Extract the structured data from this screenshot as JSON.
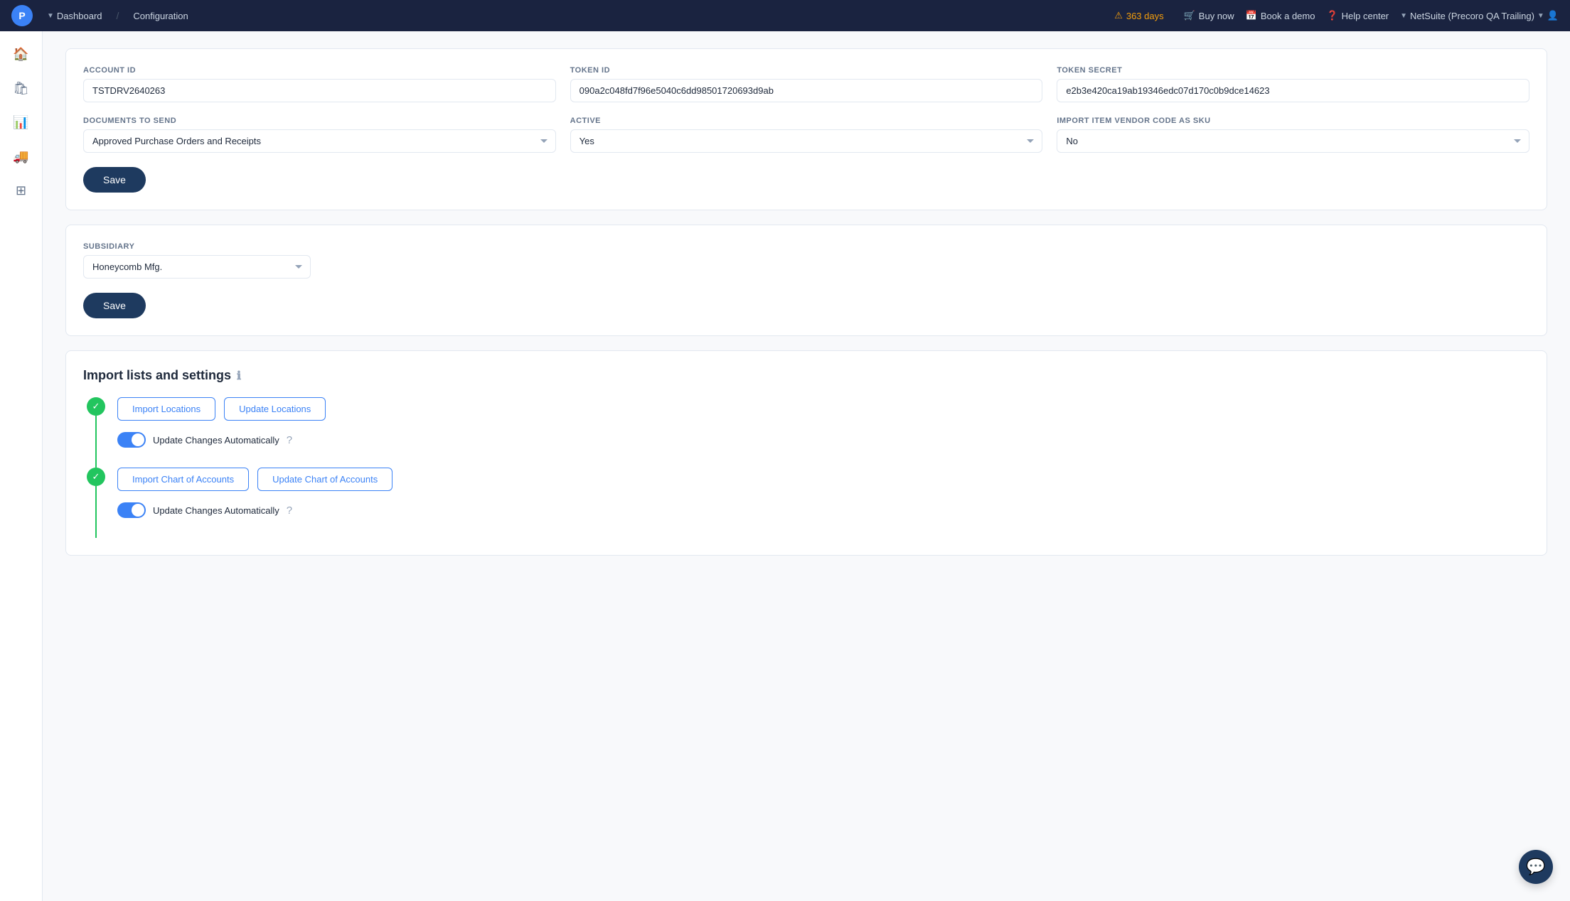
{
  "nav": {
    "logo": "P",
    "dashboard": "Dashboard",
    "configuration": "Configuration",
    "warning_days": "363 days",
    "buy_now": "Buy now",
    "book_demo": "Book a demo",
    "help_center": "Help center",
    "netsuite_label": "NetSuite (Precoro QA Trailing)"
  },
  "form": {
    "account_id_label": "ACCOUNT ID",
    "account_id_value": "TSTDRV2640263",
    "token_id_label": "TOKEN ID",
    "token_id_value": "090a2c048fd7f96e5040c6dd98501720693d9ab",
    "token_secret_label": "TOKEN SECRET",
    "token_secret_value": "e2b3e420ca19ab19346edc07d170c0b9dce14623",
    "docs_to_send_label": "DOCUMENTS TO SEND",
    "docs_to_send_value": "Approved Purchase Orders and Receipts",
    "active_label": "ACTIVE",
    "active_value": "Yes",
    "import_item_label": "IMPORT ITEM VENDOR CODE AS SKU",
    "import_item_value": "No",
    "save_label": "Save"
  },
  "subsidiary": {
    "label": "SUBSIDIARY",
    "value": "Honeycomb Mfg.",
    "save_label": "Save"
  },
  "import_section": {
    "title": "Import lists and settings",
    "items": [
      {
        "id": "locations",
        "import_btn": "Import Locations",
        "update_btn": "Update Locations",
        "toggle_label": "Update Changes Automatically"
      },
      {
        "id": "chart-of-accounts",
        "import_btn": "Import Chart of Accounts",
        "update_btn": "Update Chart of Accounts",
        "toggle_label": "Update Changes Automatically"
      }
    ]
  },
  "chat_btn": "💬"
}
